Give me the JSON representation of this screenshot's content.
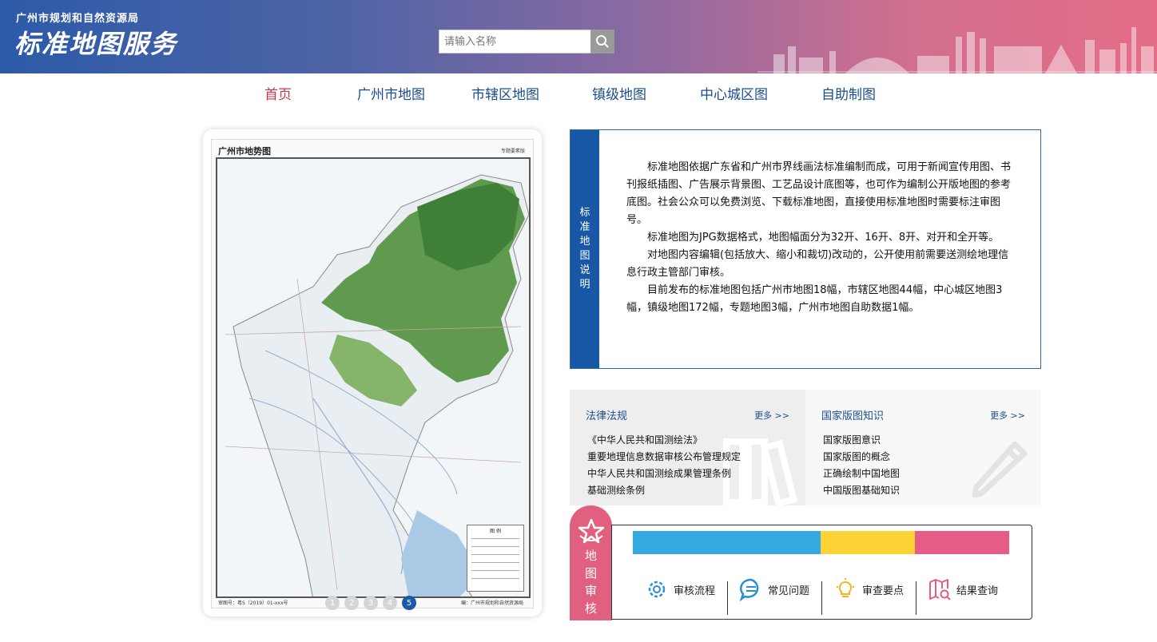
{
  "header": {
    "org": "广州市规划和自然资源局",
    "title": "标准地图服务",
    "search_placeholder": "请输入名称"
  },
  "nav": [
    {
      "label": "首页",
      "active": true
    },
    {
      "label": "广州市地图"
    },
    {
      "label": "市辖区地图"
    },
    {
      "label": "镇级地图"
    },
    {
      "label": "中心城区图"
    },
    {
      "label": "自助制图"
    }
  ],
  "map_card": {
    "title": "广州市地势图",
    "tag": "专题要素版",
    "approval_no": "审图号：粤S（2019）01-xxx号",
    "publisher": "编：广州市规划和自然资源局",
    "legend_title": "图 例",
    "pages": [
      "1",
      "2",
      "3",
      "4",
      "5"
    ],
    "active_page": "5"
  },
  "description": {
    "side_label": "标准地图说明",
    "paragraphs": [
      "标准地图依据广东省和广州市界线画法标准编制而成，可用于新闻宣传用图、书刊报纸插图、广告展示背景图、工艺品设计底图等，也可作为编制公开版地图的参考底图。社会公众可以免费浏览、下载标准地图，直接使用标准地图时需要标注审图号。",
      "标准地图为JPG数据格式，地图幅面分为32开、16开、8开、对开和全开等。",
      "对地图内容编辑(包括放大、缩小和裁切)改动的，公开使用前需要送测绘地理信息行政主管部门审核。",
      "目前发布的标准地图包括广州市地图18幅，市辖区地图44幅，中心城区地图3幅，镇级地图172幅，专题地图3幅，广州市地图自助数据1幅。"
    ]
  },
  "laws": {
    "title": "法律法规",
    "more": "更多 >>",
    "items": [
      "《中华人民共和国测绘法》",
      "重要地理信息数据审核公布管理规定",
      "中华人民共和国测绘成果管理条例",
      "基础测绘条例"
    ]
  },
  "knowledge": {
    "title": "国家版图知识",
    "more": "更多 >>",
    "items": [
      "国家版图意识",
      "国家版图的概念",
      "正确绘制中国地图",
      "中国版图基础知识"
    ]
  },
  "review": {
    "label": "地图审核",
    "bar_colors": [
      "#36a8e1",
      "#fdd235",
      "#e65c85"
    ],
    "tiles": [
      {
        "label": "审核流程",
        "icon": "gear-icon",
        "color": "#2a8fd2"
      },
      {
        "label": "常见问题",
        "icon": "chat-icon",
        "color": "#2a8fd2"
      },
      {
        "label": "审查要点",
        "icon": "lightbulb-icon",
        "color": "#f2b51c"
      },
      {
        "label": "结果查询",
        "icon": "map-search-icon",
        "color": "#e2607f"
      }
    ]
  }
}
